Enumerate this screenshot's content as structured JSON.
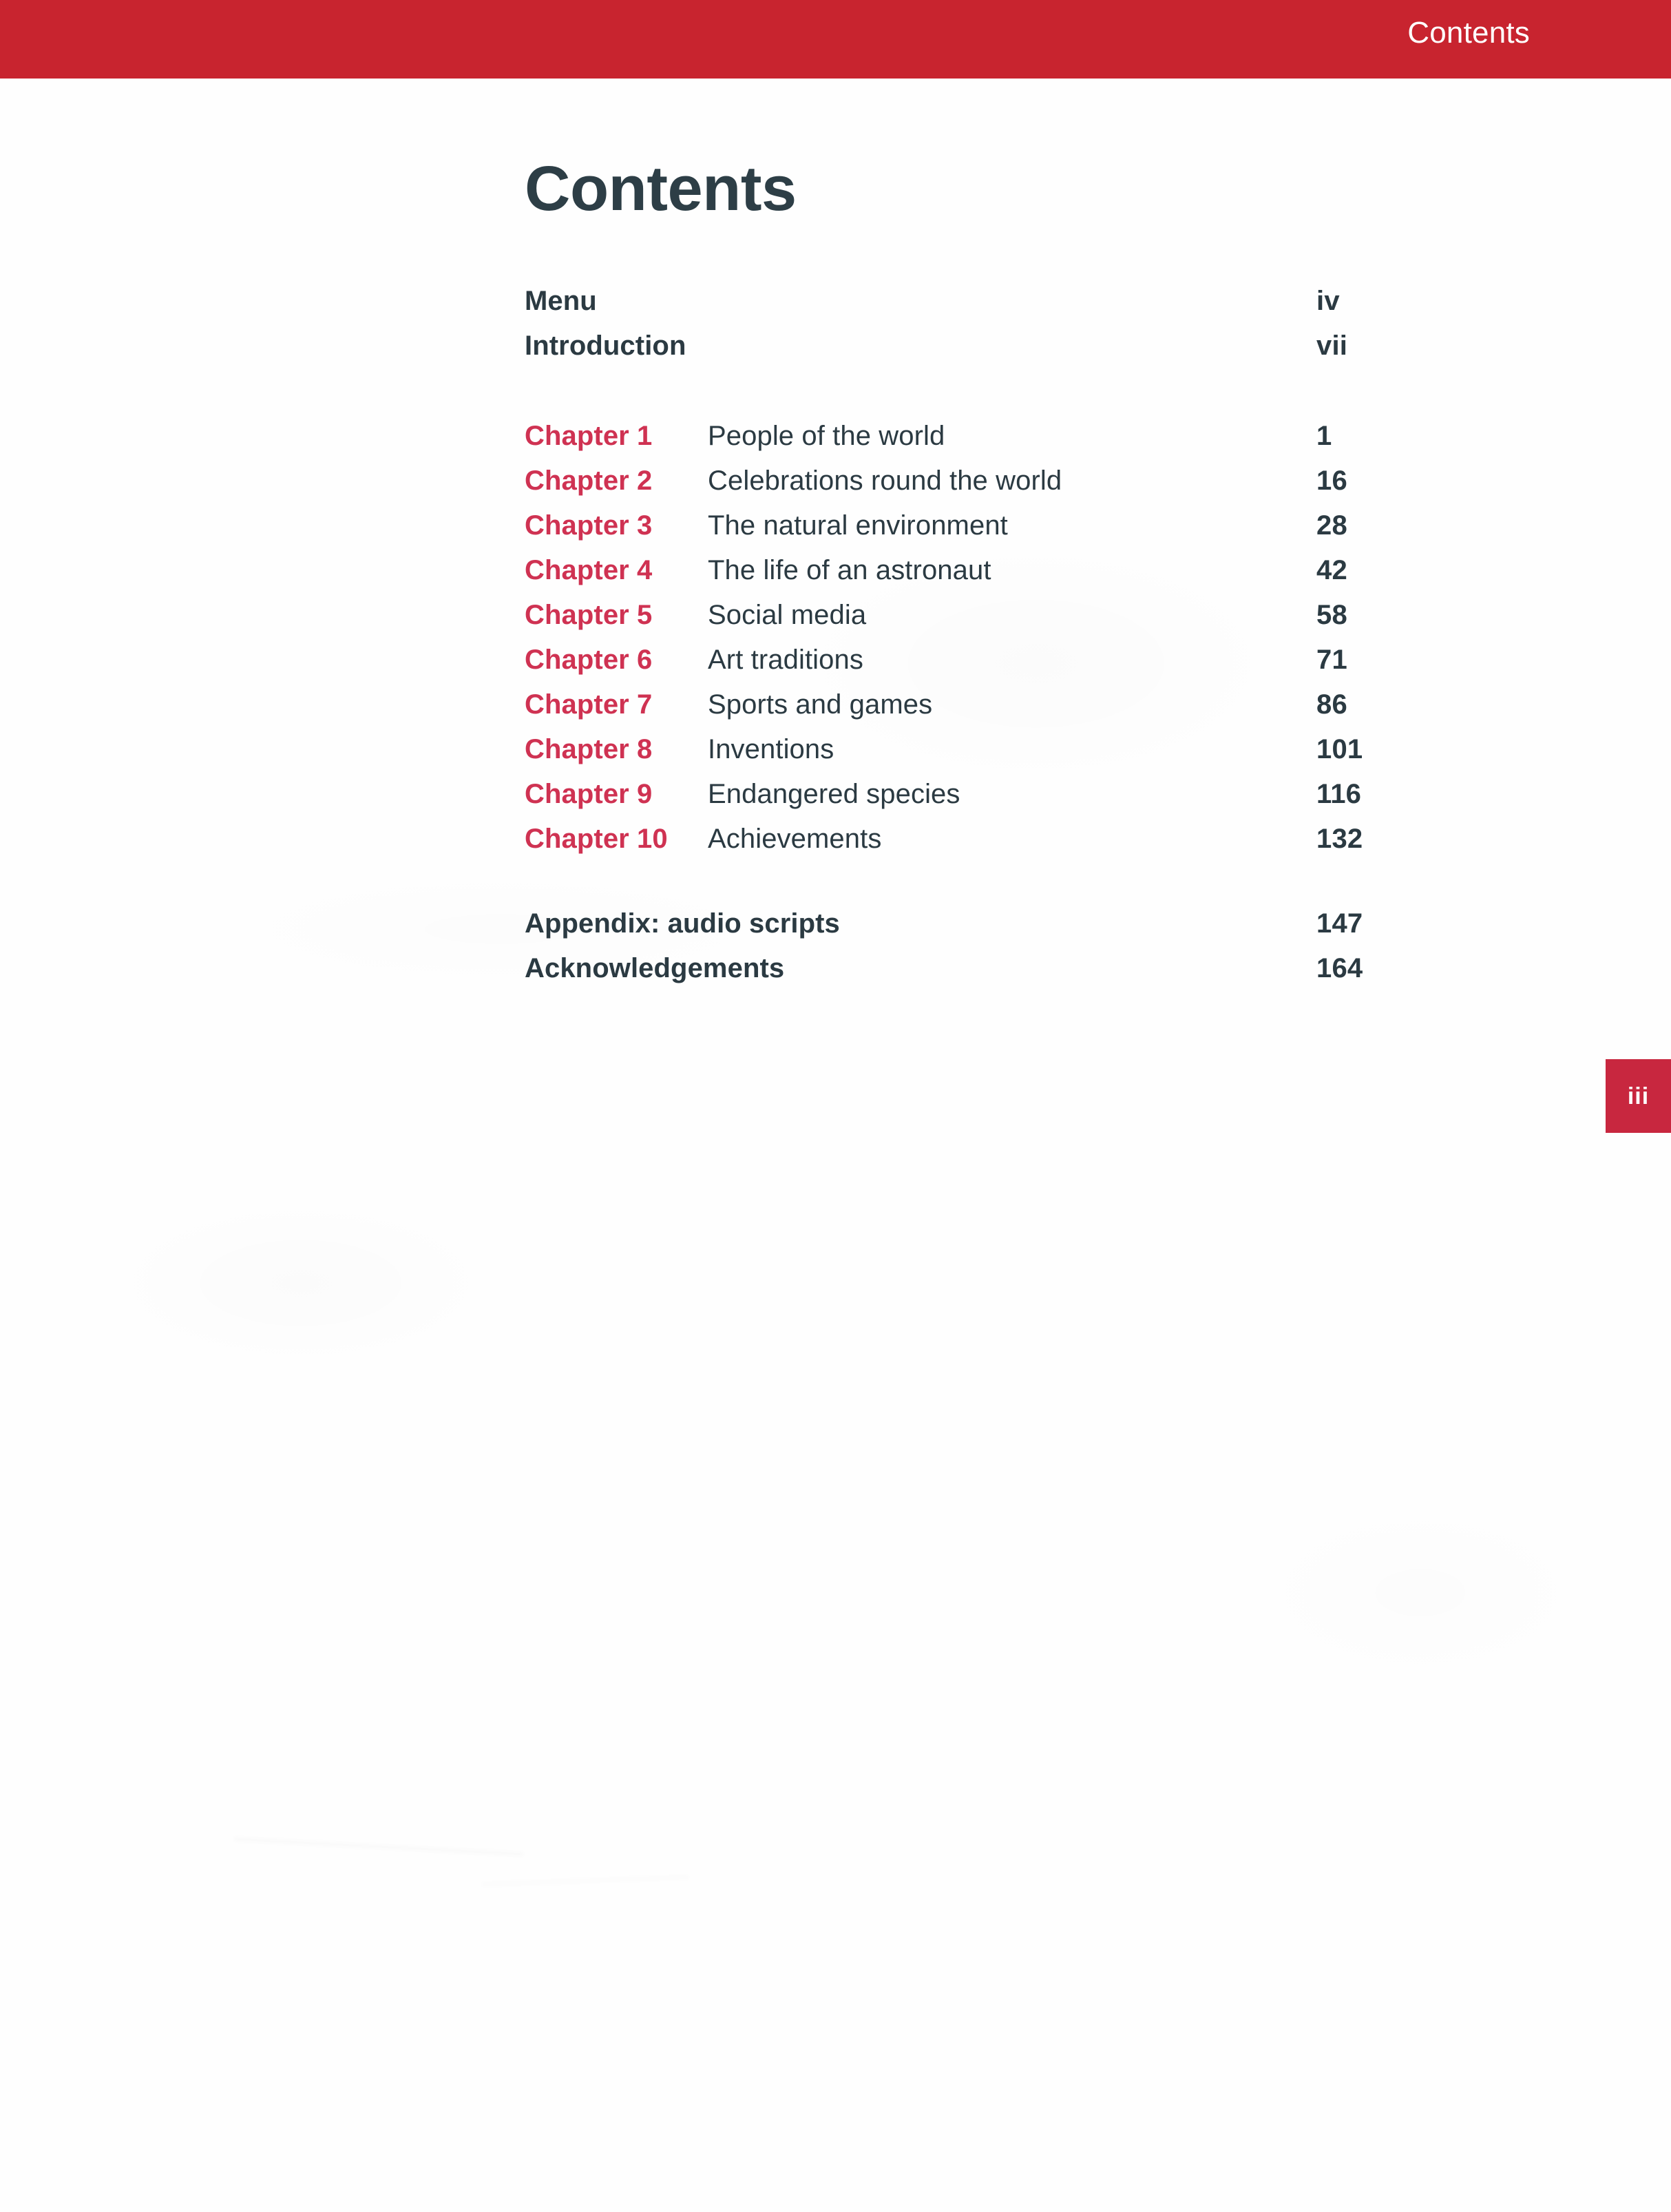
{
  "running_head": {
    "title": "Contents",
    "bar_color": "#c8242f",
    "text_color": "#ffffff"
  },
  "page_title": "Contents",
  "colors": {
    "accent_red": "#cf3252",
    "header_red": "#c8242f",
    "tab_red": "#c8273f",
    "text_dark": "#2b3a42",
    "heading_dark": "#2d3e46",
    "page_background": "#fefefe"
  },
  "front_matter": [
    {
      "label": "Menu",
      "page": "iv"
    },
    {
      "label": "Introduction",
      "page": "vii"
    }
  ],
  "chapters": [
    {
      "number": "Chapter 1",
      "title": "People of the world",
      "page": "1"
    },
    {
      "number": "Chapter 2",
      "title": "Celebrations round the world",
      "page": "16"
    },
    {
      "number": "Chapter 3",
      "title": "The natural environment",
      "page": "28"
    },
    {
      "number": "Chapter 4",
      "title": "The life of an astronaut",
      "page": "42"
    },
    {
      "number": "Chapter 5",
      "title": "Social media",
      "page": "58"
    },
    {
      "number": "Chapter 6",
      "title": "Art traditions",
      "page": "71"
    },
    {
      "number": "Chapter 7",
      "title": "Sports and games",
      "page": "86"
    },
    {
      "number": "Chapter 8",
      "title": "Inventions",
      "page": "101"
    },
    {
      "number": "Chapter 9",
      "title": "Endangered species",
      "page": "116"
    },
    {
      "number": "Chapter 10",
      "title": "Achievements",
      "page": "132"
    }
  ],
  "back_matter": [
    {
      "label": "Appendix: audio scripts",
      "page": "147"
    },
    {
      "label": "Acknowledgements",
      "page": "164"
    }
  ],
  "page_tab": {
    "label": "iii"
  }
}
